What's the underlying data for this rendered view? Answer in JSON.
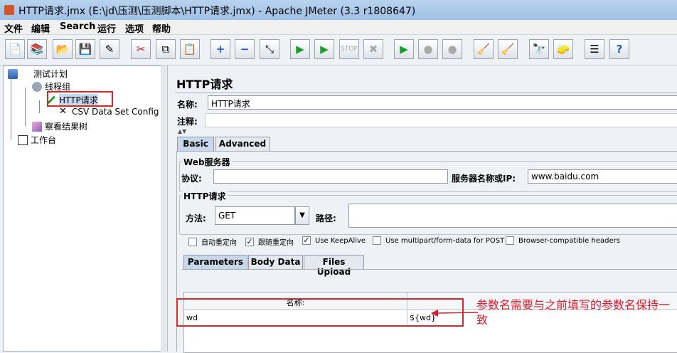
{
  "window": {
    "title": "HTTP请求.jmx (E:\\jd\\压测\\压测脚本\\HTTP请求.jmx) - Apache JMeter (3.3 r1808647)"
  },
  "menu": [
    "文件",
    "编辑",
    "Search",
    "运行",
    "选项",
    "帮助"
  ],
  "toolbar": {
    "icons": [
      "new-icon",
      "templates-icon",
      "open-icon",
      "save-icon",
      "save-as-icon",
      "cut-icon",
      "copy-icon",
      "paste-icon",
      "expand-icon",
      "collapse-icon",
      "toggle-icon",
      "start-icon",
      "start-no-pause-icon",
      "stop-icon",
      "shutdown-icon",
      "remote-start-icon",
      "remote-stop-icon",
      "remote-shutdown-icon",
      "clear-icon",
      "clear-all-icon",
      "search-icon",
      "reset-search-icon",
      "function-helper-icon",
      "help-icon"
    ]
  },
  "tree": {
    "test_plan": "测试计划",
    "thread_group": "线程组",
    "http_request": "HTTP请求",
    "csv_config": "CSV Data Set Config",
    "result_tree": "察看结果树",
    "workbench": "工作台"
  },
  "panel": {
    "title": "HTTP请求",
    "name_label": "名称:",
    "name_value": "HTTP请求",
    "comment_label": "注释:",
    "comment_value": "",
    "tabs": [
      "Basic",
      "Advanced"
    ],
    "web_server": {
      "group_title": "Web服务器",
      "protocol_label": "协议:",
      "protocol_value": "",
      "server_label": "服务器名称或IP:",
      "server_value": "www.baidu.com"
    },
    "http_request": {
      "group_title": "HTTP请求",
      "method_label": "方法:",
      "method_value": "GET",
      "path_label": "路径:",
      "path_value": ""
    },
    "checkboxes": [
      {
        "label": "自动重定向",
        "checked": false
      },
      {
        "label": "跟随重定向",
        "checked": true
      },
      {
        "label": "Use KeepAlive",
        "checked": true
      },
      {
        "label": "Use multipart/form-data for POST",
        "checked": false
      },
      {
        "label": "Browser-compatible headers",
        "checked": false
      }
    ],
    "subtabs": [
      "Parameters",
      "Body Data",
      "Files Upload"
    ],
    "table": {
      "headers": [
        "名称:",
        ""
      ],
      "rows": [
        {
          "name": "wd",
          "value": "${wd}"
        }
      ]
    }
  },
  "annotation": "参数名需要与之前填写的参数名保持一致"
}
